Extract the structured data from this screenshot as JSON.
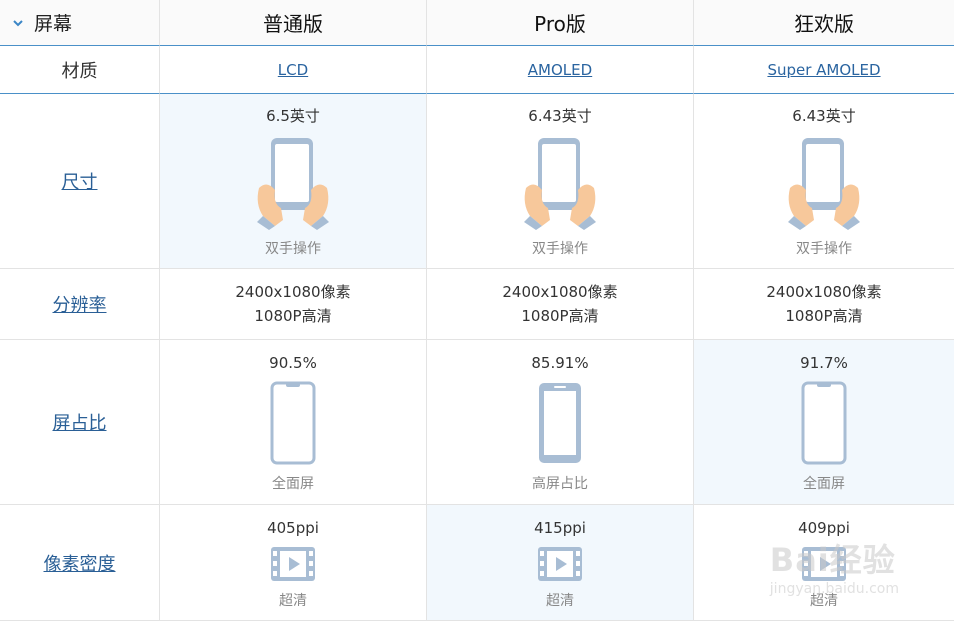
{
  "header": {
    "section_title": "屏幕",
    "columns": [
      "普通版",
      "Pro版",
      "狂欢版"
    ]
  },
  "rows": {
    "material": {
      "label": "材质",
      "values": [
        "LCD",
        "AMOLED",
        "Super AMOLED"
      ]
    },
    "size": {
      "label": "尺寸",
      "values": [
        "6.5英寸",
        "6.43英寸",
        "6.43英寸"
      ],
      "captions": [
        "双手操作",
        "双手操作",
        "双手操作"
      ]
    },
    "resolution": {
      "label": "分辨率",
      "line1": [
        "2400x1080像素",
        "2400x1080像素",
        "2400x1080像素"
      ],
      "line2": [
        "1080P高清",
        "1080P高清",
        "1080P高清"
      ]
    },
    "screen_ratio": {
      "label": "屏占比",
      "values": [
        "90.5%",
        "85.91%",
        "91.7%"
      ],
      "captions": [
        "全面屏",
        "高屏占比",
        "全面屏"
      ]
    },
    "pixel_density": {
      "label": "像素密度",
      "values": [
        "405ppi",
        "415ppi",
        "409ppi"
      ],
      "captions": [
        "超清",
        "超清",
        "超清"
      ]
    }
  },
  "watermark": {
    "brand": "Bai经验",
    "url": "jingyan.baidu.com"
  },
  "colors": {
    "accent": "#4a90c8",
    "highlight_bg": "#f2f8fd",
    "link": "#2a64a0",
    "icon": "#a8bdd4",
    "hand": "#f7c89b"
  }
}
